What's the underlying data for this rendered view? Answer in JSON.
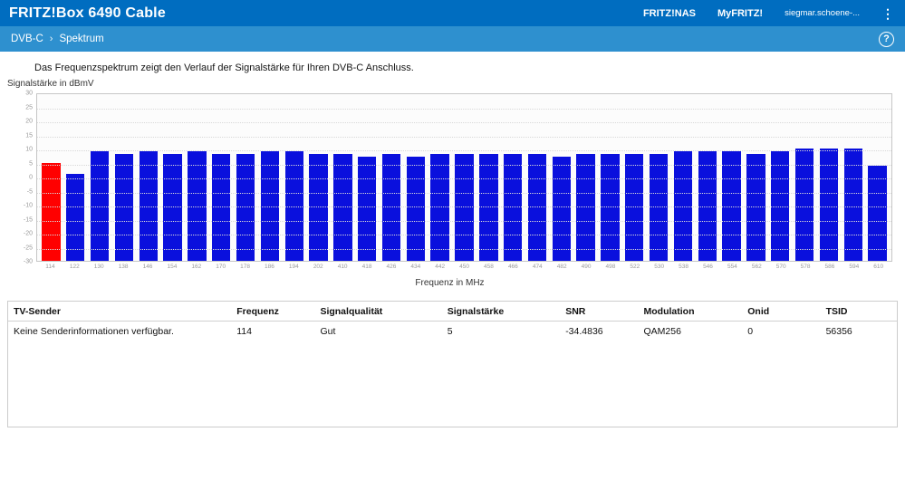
{
  "header": {
    "title": "FRITZ!Box 6490 Cable",
    "links": [
      {
        "label": "FRITZ!NAS"
      },
      {
        "label": "MyFRITZ!"
      }
    ],
    "user": "siegmar.schoene-...",
    "menu_glyph": "⋮"
  },
  "breadcrumb": {
    "section": "DVB-C",
    "separator": "›",
    "page": "Spektrum",
    "help_glyph": "?"
  },
  "intro": "Das Frequenzspektrum zeigt den Verlauf der Signalstärke für Ihren DVB-C Anschluss.",
  "chart_data": {
    "type": "bar",
    "title": "",
    "ylabel": "Signalstärke in dBmV",
    "xlabel": "Frequenz in MHz",
    "ylim": [
      -30,
      30
    ],
    "ytick_step": 5,
    "grid": "dotted-horizontal",
    "legend": "none",
    "categories": [
      "114",
      "122",
      "130",
      "138",
      "146",
      "154",
      "162",
      "170",
      "178",
      "186",
      "194",
      "202",
      "410",
      "418",
      "426",
      "434",
      "442",
      "450",
      "458",
      "466",
      "474",
      "482",
      "490",
      "498",
      "522",
      "530",
      "538",
      "546",
      "554",
      "562",
      "570",
      "578",
      "586",
      "594",
      "610"
    ],
    "values": [
      5,
      1,
      9,
      8,
      9,
      8,
      9,
      8,
      8,
      9,
      9,
      8,
      8,
      7,
      8,
      7,
      8,
      8,
      8,
      8,
      8,
      7,
      8,
      8,
      8,
      8,
      9,
      9,
      9,
      8,
      9,
      10,
      10,
      10,
      4
    ],
    "bar_color": "#0a10dd",
    "highlight_color": "#ff0000",
    "highlight_index": 0
  },
  "table": {
    "headers": [
      "TV-Sender",
      "Frequenz",
      "Signalqualität",
      "Signalstärke",
      "SNR",
      "Modulation",
      "Onid",
      "TSID"
    ],
    "col_widths": [
      "25.1%",
      "9.4%",
      "14.3%",
      "13.3%",
      "8.8%",
      "11.7%",
      "8.8%",
      "8.6%"
    ],
    "rows": [
      [
        "Keine Senderinformationen verfügbar.",
        "114",
        "Gut",
        "5",
        "-34.4836",
        "QAM256",
        "0",
        "56356"
      ]
    ]
  },
  "colors": {
    "header_bg": "#006dc0",
    "subheader_bg": "#2e90cf",
    "bar": "#0a10dd",
    "bar_highlight": "#ff0000"
  }
}
